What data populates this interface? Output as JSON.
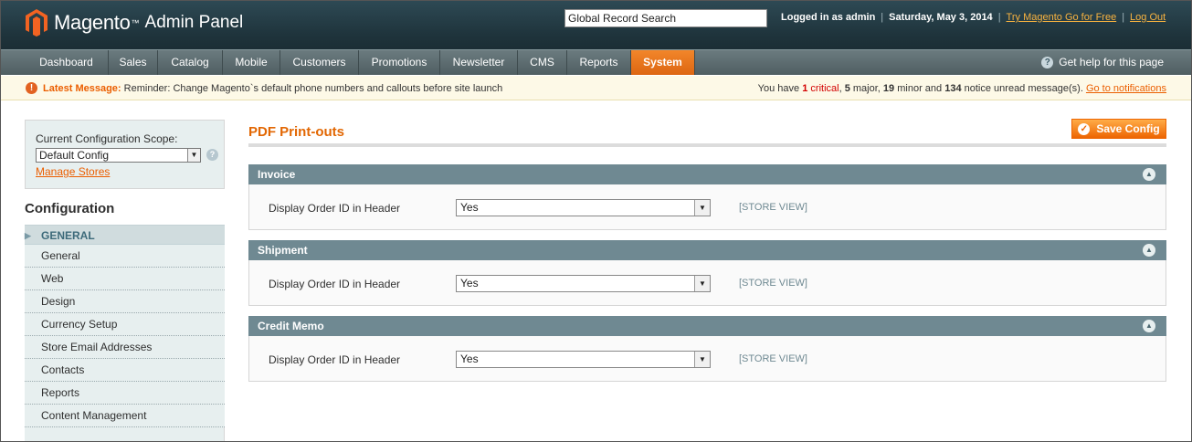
{
  "header": {
    "logo_text": "Magento",
    "logo_tm": "™",
    "logo_sub": "Admin Panel",
    "search_value": "Global Record Search",
    "logged_in": "Logged in as admin",
    "date": "Saturday, May 3, 2014",
    "try_link": "Try Magento Go for Free",
    "logout": "Log Out",
    "separator": "|"
  },
  "nav": {
    "items": [
      "Dashboard",
      "Sales",
      "Catalog",
      "Mobile",
      "Customers",
      "Promotions",
      "Newsletter",
      "CMS",
      "Reports",
      "System"
    ],
    "active": "System",
    "help": "Get help for this page"
  },
  "message": {
    "label": "Latest Message:",
    "text": "Reminder: Change Magento`s default phone numbers and callouts before site launch",
    "right_prefix": "You have",
    "critical_count": "1",
    "critical_word": "critical",
    "major_count": "5",
    "major_word": "major,",
    "minor_count": "19",
    "minor_word": "minor and",
    "notice_count": "134",
    "notice_word": "notice unread message(s).",
    "link": "Go to notifications"
  },
  "sidebar": {
    "scope_label": "Current Configuration Scope:",
    "scope_value": "Default Config",
    "manage_stores": "Manage Stores",
    "config_title": "Configuration",
    "group_header": "GENERAL",
    "items": [
      "General",
      "Web",
      "Design",
      "Currency Setup",
      "Store Email Addresses",
      "Contacts",
      "Reports",
      "Content Management"
    ]
  },
  "main": {
    "title": "PDF Print-outs",
    "save_label": "Save Config",
    "sections": [
      {
        "title": "Invoice",
        "field_label": "Display Order ID in Header",
        "value": "Yes",
        "scope": "[STORE VIEW]"
      },
      {
        "title": "Shipment",
        "field_label": "Display Order ID in Header",
        "value": "Yes",
        "scope": "[STORE VIEW]"
      },
      {
        "title": "Credit Memo",
        "field_label": "Display Order ID in Header",
        "value": "Yes",
        "scope": "[STORE VIEW]"
      }
    ]
  },
  "colors": {
    "accent": "#eb5e00",
    "header_bg": "#2e4a55",
    "section_header": "#6f8992"
  }
}
